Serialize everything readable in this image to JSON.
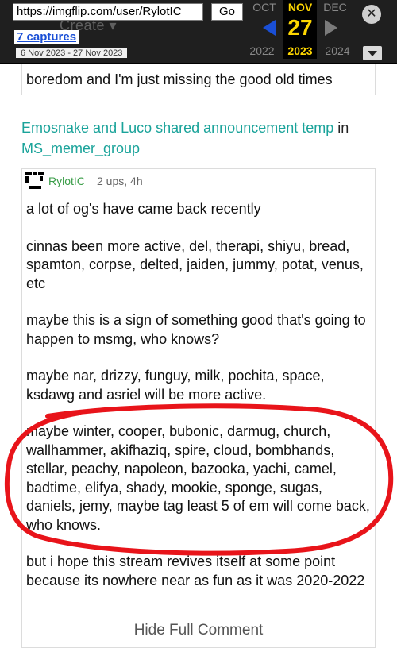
{
  "wayback": {
    "url": "https://imgflip.com/user/RylotIC",
    "go_label": "Go",
    "captures": "7 captures",
    "range": "6 Nov 2023 - 27 Nov 2023",
    "prev_month": "OCT",
    "cur_month": "NOV",
    "next_month": "DEC",
    "cur_day": "27",
    "prev_year": "2022",
    "cur_year": "2023",
    "next_year": "2024",
    "ghost_text": "Create ▾"
  },
  "previous_comment": {
    "text": "boredom and I'm just missing the good old times"
  },
  "post": {
    "title": "Emosnake and Luco shared announcement temp",
    "in_label": "in",
    "stream": "MS_memer_group"
  },
  "comment": {
    "username": "RylotIC",
    "meta": "2 ups, 4h",
    "paragraphs": [
      "a lot of og's have came back recently",
      "cinnas been more active, del, therapi, shiyu, bread, spamton, corpse, delted, jaiden, jummy, potat, venus, etc",
      "maybe this is a sign of something good that's going to happen to msmg, who knows?",
      "maybe nar, drizzy, funguy, milk, pochita, space, ksdawg and asriel will be more active.",
      "maybe winter, cooper, bubonic, darmug, church, wallhammer, akifhaziq, spire, cloud, bombhands, stellar, peachy, napoleon, bazooka, yachi, camel, badtime, elifya, shady, mookie, sponge, sugas, daniels, jemy, maybe tag least 5 of em will come back, who knows.",
      "but i hope this stream revives itself at some point because its nowhere near as fun as it was 2020-2022"
    ],
    "hide_label": "Hide Full Comment"
  },
  "colors": {
    "link": "#1aa39a",
    "username": "#3a9d48",
    "wayback_blue": "#1a4fd6",
    "wayback_gold": "#ffd700",
    "annotation_red": "#e8141a"
  }
}
